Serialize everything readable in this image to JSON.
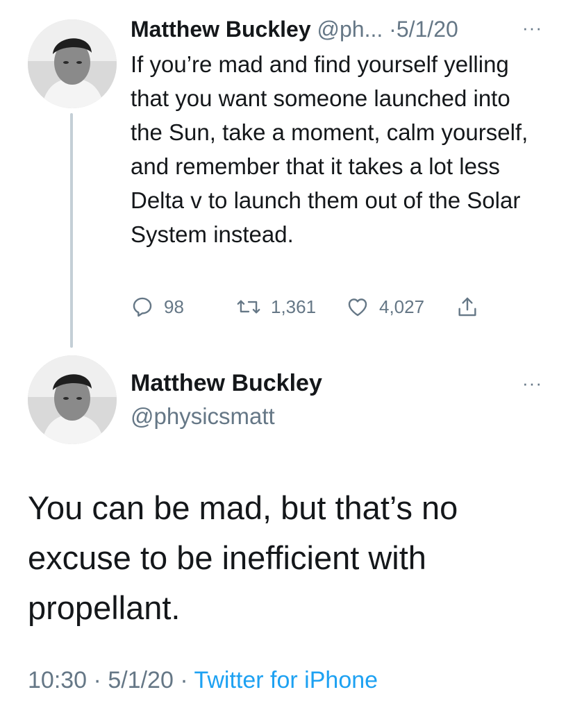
{
  "tweet1": {
    "display_name": "Matthew Buckley",
    "handle": "@ph...",
    "separator": "·",
    "date": "5/1/20",
    "more_label": "···",
    "text": "If you’re mad and find yourself yelling that you want someone launched into the Sun, take a moment, calm yourself, and remember that it takes a lot less Delta v to launch them out of the Solar System instead.",
    "replies": "98",
    "retweets": "1,361",
    "likes": "4,027"
  },
  "tweet2": {
    "display_name": "Matthew Buckley",
    "handle": "@physicsmatt",
    "more_label": "···",
    "text": "You can be mad, but that’s no excuse to be inefficient with propellant.",
    "time": "10:30",
    "separator": "·",
    "date": "5/1/20",
    "source": "Twitter for iPhone"
  },
  "icons": {
    "reply": "reply-icon",
    "retweet": "retweet-icon",
    "like": "heart-icon",
    "share": "share-icon"
  },
  "colors": {
    "text": "#14171a",
    "secondary": "#657786",
    "link": "#1da1f2",
    "thread_line": "#c4cfd6"
  }
}
